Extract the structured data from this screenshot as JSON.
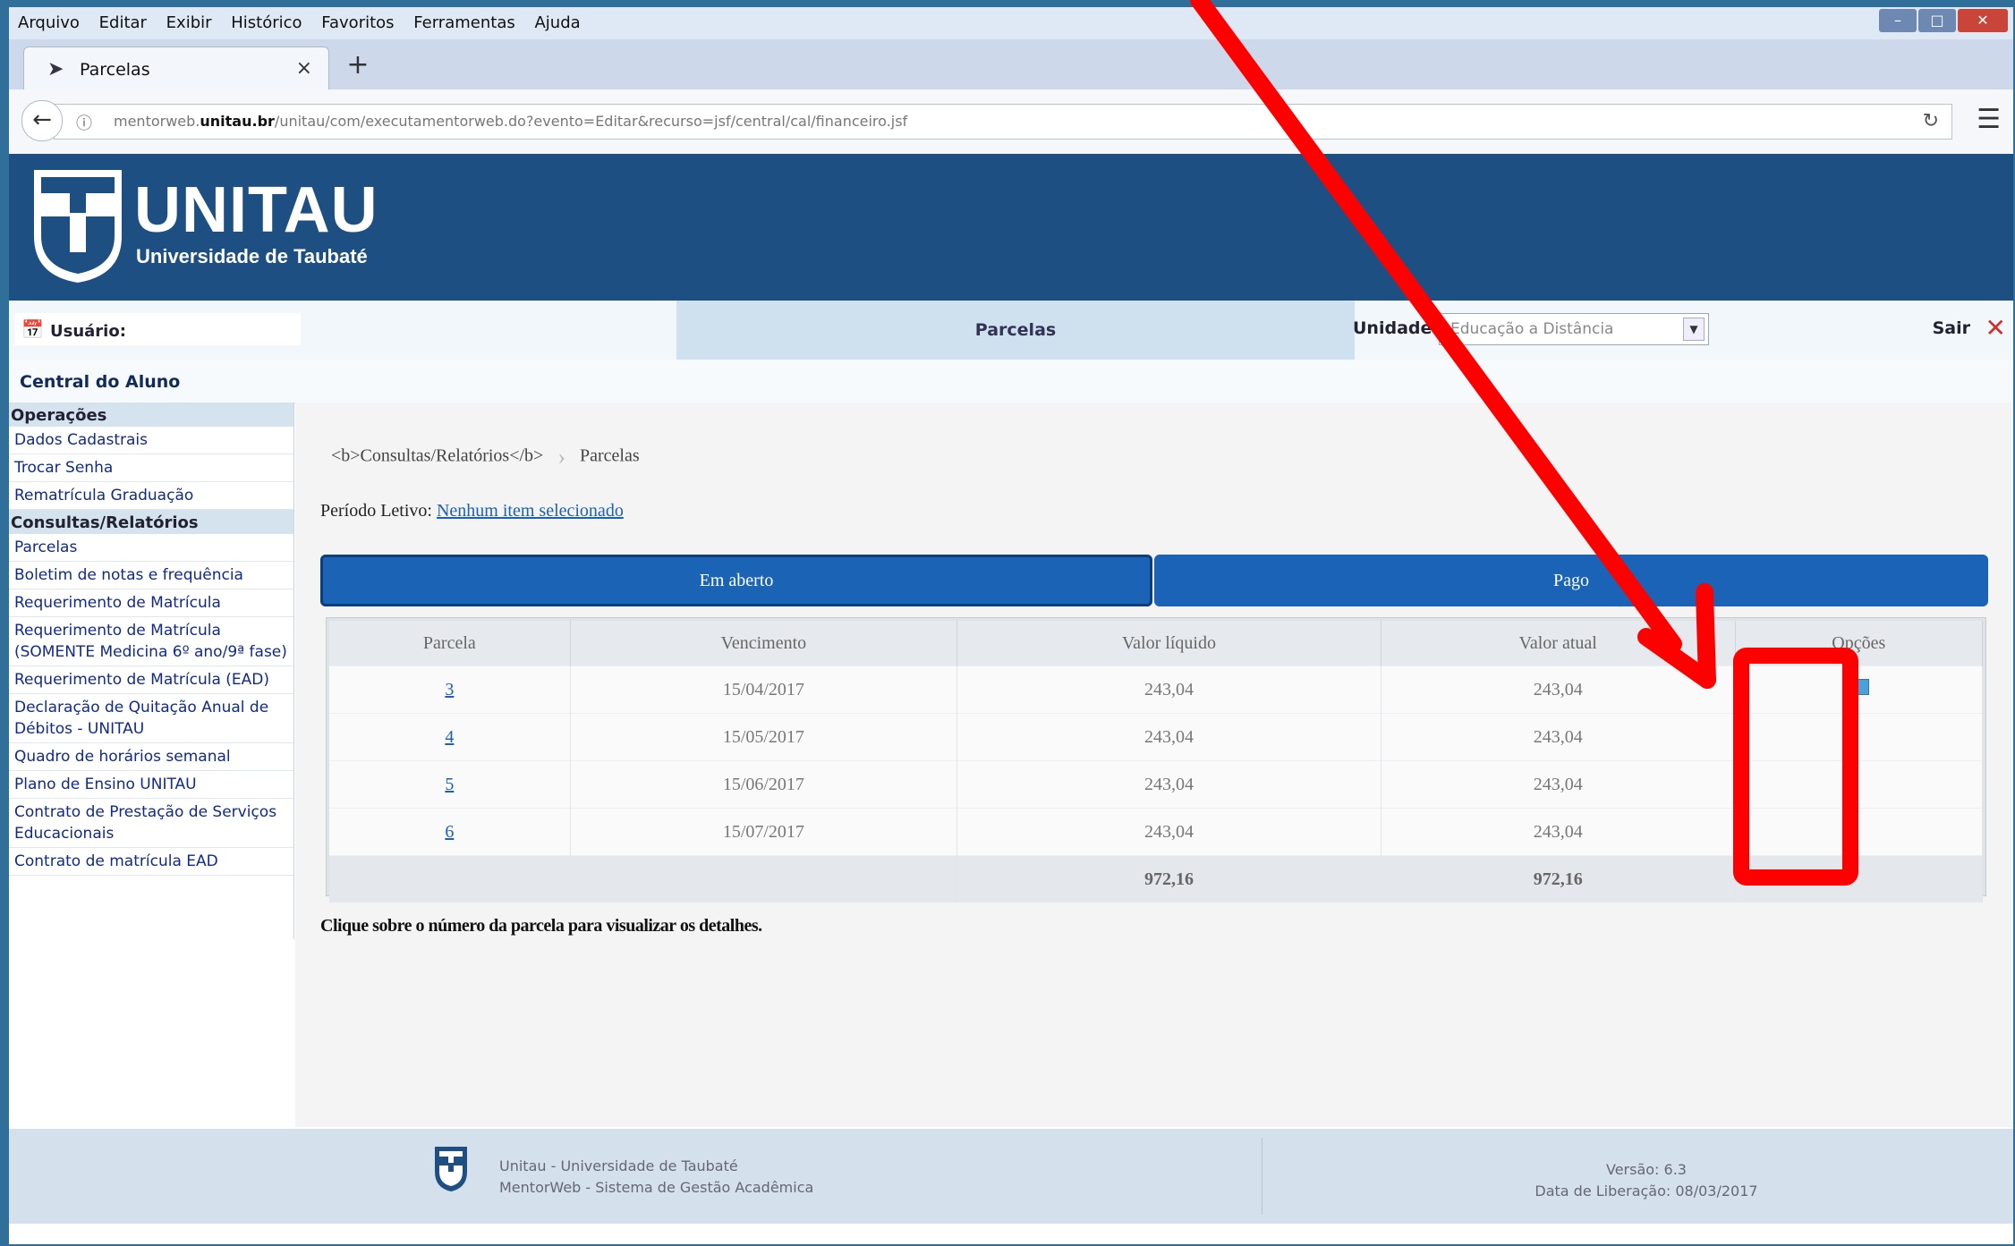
{
  "browser": {
    "menu": [
      "Arquivo",
      "Editar",
      "Exibir",
      "Histórico",
      "Favoritos",
      "Ferramentas",
      "Ajuda"
    ],
    "tab_title": "Parcelas",
    "url_host": "mentorweb.unitau.br",
    "url_prefix": "mentorweb.",
    "url_bold": "unitau.br",
    "url_path": "/unitau/com/executamentorweb.do?evento=Editar&recurso=jsf/central/cal/financeiro.jsf"
  },
  "header": {
    "brand": "UNITAU",
    "subtitle": "Universidade de Taubaté"
  },
  "infobar": {
    "user_label": "Usuário:",
    "page_title": "Parcelas",
    "unidade_label": "Unidade",
    "unidade_value": "Educação a Distância",
    "logout_label": "Sair"
  },
  "central": "Central do Aluno",
  "sidebar": {
    "sections": [
      {
        "title": "Operações",
        "items": [
          "Dados Cadastrais",
          "Trocar Senha",
          "Rematrícula Graduação"
        ]
      },
      {
        "title": "Consultas/Relatórios",
        "items": [
          "Parcelas",
          "Boletim de notas e frequência",
          "Requerimento de Matrícula",
          "Requerimento de Matrícula (SOMENTE Medicina 6º ano/9ª fase)",
          "Requerimento de Matrícula (EAD)",
          "Declaração de Quitação Anual de Débitos - UNITAU",
          "Quadro de horários semanal",
          "Plano de Ensino UNITAU",
          "Contrato de Prestação de Serviços Educacionais",
          "Contrato de matrícula EAD"
        ]
      }
    ]
  },
  "main": {
    "breadcrumb": [
      "<b>Consultas/Relatórios</b>",
      "Parcelas"
    ],
    "periodo_label": "Período Letivo:",
    "periodo_link": "Nenhum item selecionado",
    "tabs": [
      "Em aberto",
      "Pago"
    ],
    "table": {
      "headers": [
        "Parcela",
        "Vencimento",
        "Valor líquido",
        "Valor atual",
        "Opções"
      ],
      "rows": [
        {
          "parcela": "3",
          "vencimento": "15/04/2017",
          "liquido": "243,04",
          "atual": "243,04"
        },
        {
          "parcela": "4",
          "vencimento": "15/05/2017",
          "liquido": "243,04",
          "atual": "243,04"
        },
        {
          "parcela": "5",
          "vencimento": "15/06/2017",
          "liquido": "243,04",
          "atual": "243,04"
        },
        {
          "parcela": "6",
          "vencimento": "15/07/2017",
          "liquido": "243,04",
          "atual": "243,04"
        }
      ],
      "total_liquido": "972,16",
      "total_atual": "972,16"
    },
    "hint": "Clique sobre o número da parcela para visualizar os detalhes."
  },
  "footer": {
    "line1": "Unitau - Universidade de Taubaté",
    "line2": "MentorWeb - Sistema de Gestão Acadêmica",
    "version": "Versão: 6.3",
    "release": "Data de Liberação: 08/03/2017"
  },
  "colors": {
    "header_blue": "#1e4f82",
    "tab_blue": "#1b63b4",
    "annotation_red": "#ff0000"
  }
}
